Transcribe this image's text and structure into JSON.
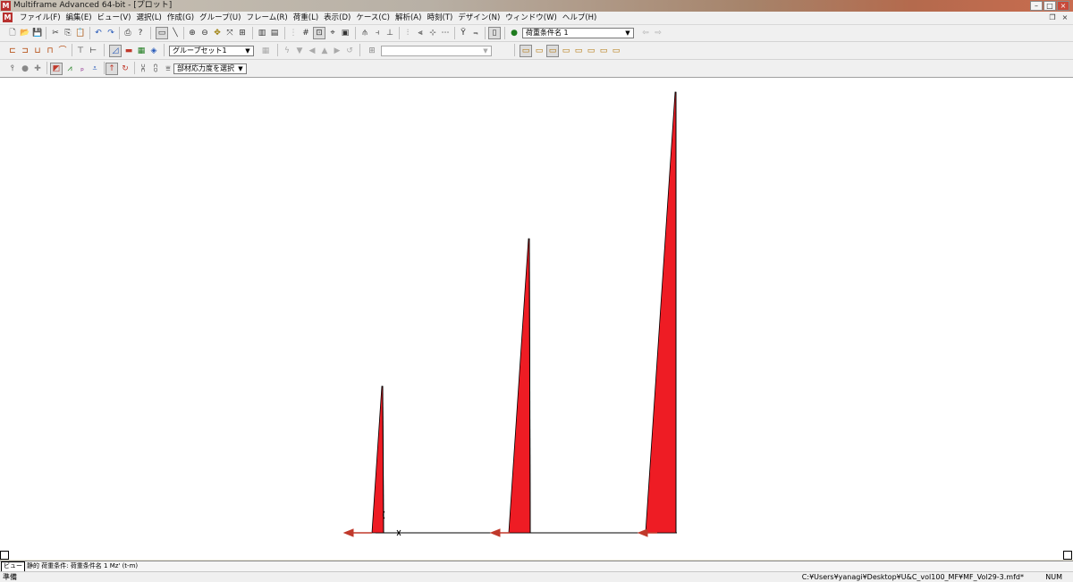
{
  "window": {
    "title": "Multiframe Advanced 64-bit - [プロット]",
    "app_icon_letter": "M",
    "controls": [
      "minimize",
      "maximize",
      "close"
    ]
  },
  "menu": {
    "items": [
      "ファイル(F)",
      "編集(E)",
      "ビュー(V)",
      "選択(L)",
      "作成(G)",
      "グループ(U)",
      "フレーム(R)",
      "荷重(L)",
      "表示(D)",
      "ケース(C)",
      "解析(A)",
      "時刻(T)",
      "デザイン(N)",
      "ウィンドウ(W)",
      "ヘルプ(H)"
    ],
    "mdi_controls": [
      "restore",
      "close"
    ]
  },
  "toolbar1": {
    "load_case_selected": "荷重条件名 1"
  },
  "toolbar2": {
    "group_set_selected": "グループセット1",
    "blank_combo_value": ""
  },
  "toolbar3": {
    "member_stress_selected": "部材応力度を選択"
  },
  "diagram": {
    "description_color": "#ee1c24",
    "arrow_color": "#c0392b"
  },
  "tabs": {
    "view_tab": "ビュー",
    "info": "静的 荷重条件: 荷重条件名 1  Mz' (t-m)"
  },
  "status": {
    "ready": "準備",
    "file_path": "C:¥Users¥yanagi¥Desktop¥U&C_vol100_MF¥MF_Vol29-3.mfd*",
    "num": "NUM"
  }
}
